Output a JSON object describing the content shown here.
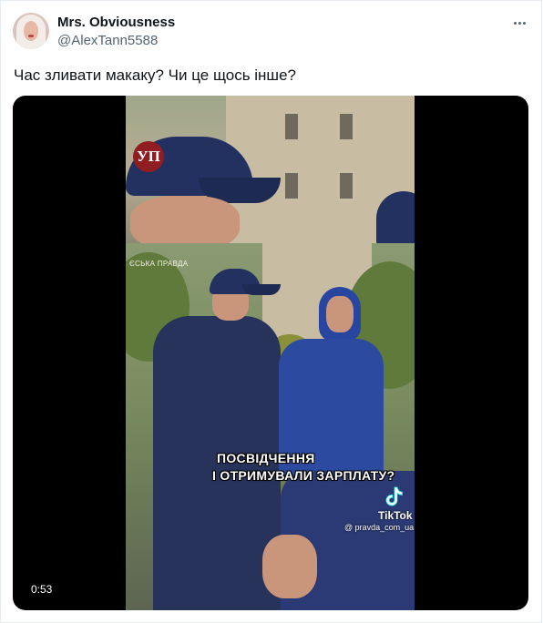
{
  "tweet": {
    "author_name": "Mrs. Obviousness",
    "author_handle": "@AlexTann5588",
    "text": "Час зливати макаку? Чи це щось інше?"
  },
  "video": {
    "duration": "0:53",
    "logo_text": "УП",
    "watermark_text": "ЄСЬКА ПРАВДА",
    "subtitle_line1": "ПОСВІДЧЕННЯ",
    "subtitle_line2": "І ОТРИМУВАЛИ ЗАРПЛАТУ?",
    "tiktok_label": "TikTok",
    "tiktok_handle": "@ pravda_com_ua"
  },
  "icons": {
    "more": "more-dots-icon",
    "tiktok": "tiktok-logo-icon"
  },
  "colors": {
    "name": "#0f1419",
    "secondary": "#536471",
    "video_bg": "#000000"
  }
}
